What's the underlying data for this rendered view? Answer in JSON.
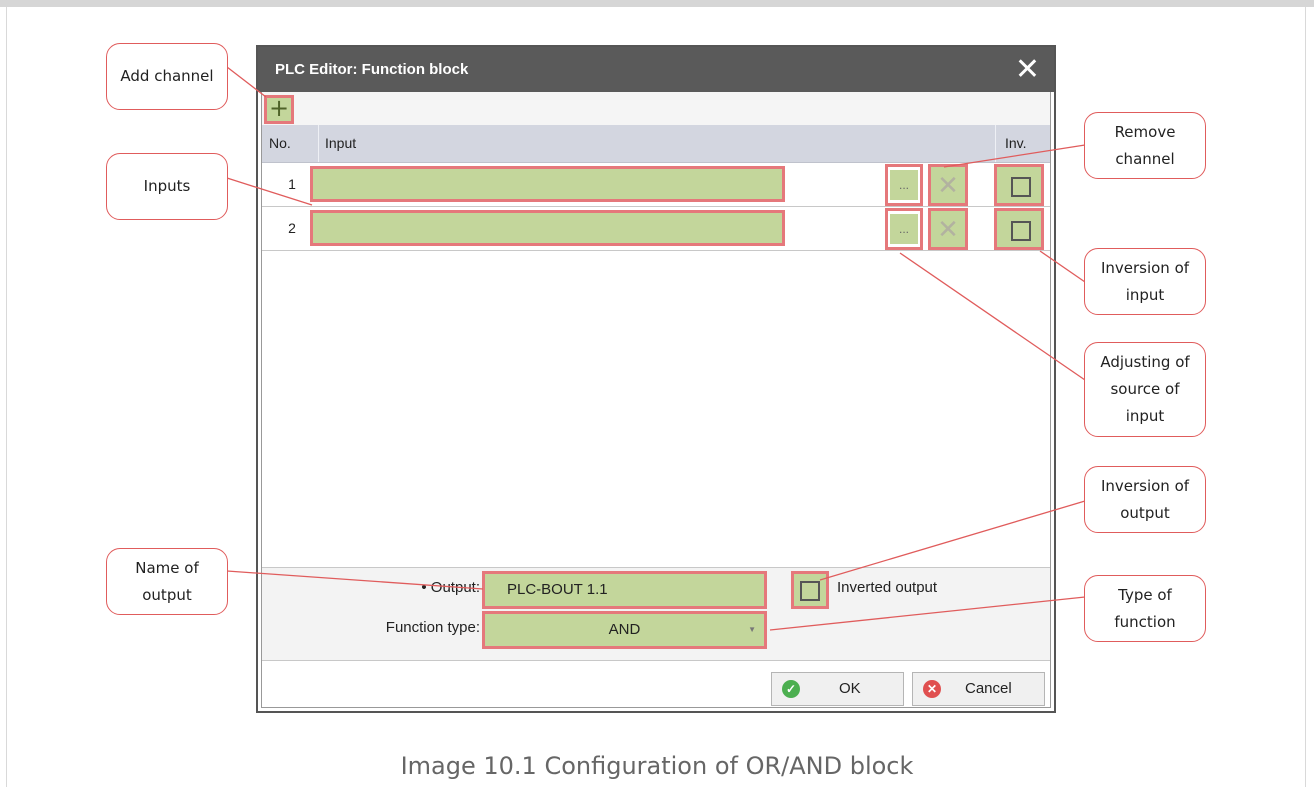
{
  "dialog": {
    "title": "PLC Editor: Function block",
    "close_glyph": "✕",
    "add_glyph": "+",
    "columns": {
      "no": "No.",
      "input": "Input",
      "inv": "Inv."
    },
    "rows": [
      {
        "no": "1",
        "value": ""
      },
      {
        "no": "2",
        "value": ""
      }
    ],
    "dots_label": "...",
    "remove_glyph": "✕",
    "output_label": "• Output:",
    "output_value": "PLC-BOUT 1.1",
    "inverted_output_label": "Inverted output",
    "function_type_label": "Function type:",
    "function_type_value": "AND",
    "ok_label": "OK",
    "cancel_label": "Cancel"
  },
  "callouts": {
    "add_channel": "Add channel",
    "inputs": "Inputs",
    "remove_channel_1": "Remove",
    "remove_channel_2": "channel",
    "inversion_input_1": "Inversion of",
    "inversion_input_2": "input",
    "adjusting_1": "Adjusting of",
    "adjusting_2": "source of",
    "adjusting_3": "input",
    "inversion_output_1": "Inversion of",
    "inversion_output_2": "output",
    "name_output_1": "Name of",
    "name_output_2": "output",
    "type_function_1": "Type of",
    "type_function_2": "function"
  },
  "caption": "Image 10.1 Configuration of OR/AND block",
  "colors": {
    "highlight_fill": "#c3d69b",
    "highlight_border": "#e5787b",
    "callout_line": "#e05c5c",
    "titlebar": "#5a5a5a",
    "ok_icon": "#4caf50",
    "cancel_icon": "#e05050"
  }
}
